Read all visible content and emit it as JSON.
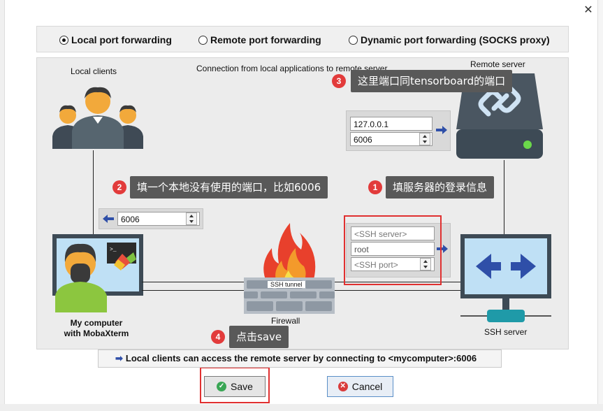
{
  "window": {
    "close_glyph": "✕"
  },
  "modes": {
    "local": "Local port forwarding",
    "remote": "Remote port forwarding",
    "dynamic": "Dynamic port forwarding (SOCKS proxy)",
    "selected": "local"
  },
  "diagram": {
    "local_clients_label": "Local clients",
    "connection_label": "Connection from local applications to remote server",
    "remote_server_label": "Remote server",
    "my_computer_label_line1": "My computer",
    "my_computer_label_line2": "with MobaXterm",
    "firewall_label": "Firewall",
    "ssh_tunnel_label": "SSH tunnel",
    "ssh_server_label": "SSH server"
  },
  "fields": {
    "remote_host": "127.0.0.1",
    "remote_port": "6006",
    "local_port": "6006",
    "ssh_server_placeholder": "<SSH server>",
    "ssh_user": "root",
    "ssh_port_placeholder": "<SSH port>"
  },
  "annotations": [
    {
      "num": "1",
      "text": "填服务器的登录信息"
    },
    {
      "num": "2",
      "text": "填一个本地没有使用的端口，比如6006"
    },
    {
      "num": "3",
      "text": "这里端口同tensorboard的端口"
    },
    {
      "num": "4",
      "text": "点击save"
    }
  ],
  "info_bar": {
    "arrow": "➡",
    "text": "Local clients can access the remote server by connecting to <mycomputer>:6006"
  },
  "buttons": {
    "save": "Save",
    "cancel": "Cancel"
  },
  "colors": {
    "callout_bg": "#595959",
    "badge_red": "#e23b3b",
    "highlight_red": "#e03030",
    "arrow_blue": "#2f4fa8",
    "server_dark": "#3d4a55",
    "ssh_screen": "#bfe0f5"
  }
}
